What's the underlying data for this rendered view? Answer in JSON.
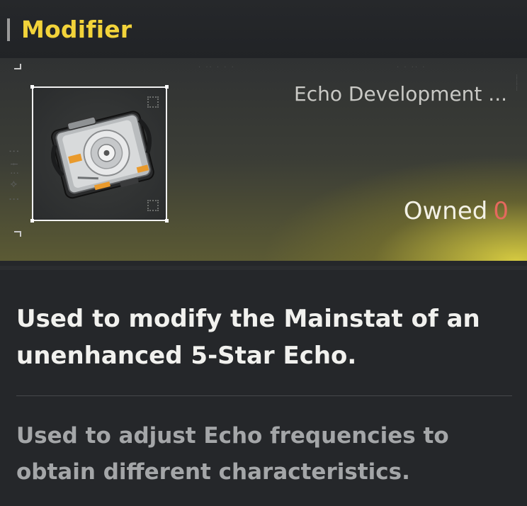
{
  "header": {
    "title": "Modifier"
  },
  "item": {
    "type_label": "Echo Development ...",
    "owned_label": "Owned",
    "owned_count": "0",
    "icon_name": "echo-modifier-device-icon"
  },
  "description": {
    "main": "Used to modify the Mainstat of an unenhanced 5-Star Echo.",
    "lore": "Used to adjust Echo frequencies to obtain different characteristics."
  },
  "colors": {
    "title": "#f2d33a",
    "owned_count": "#e5695e",
    "hero_glow": "#e2d642"
  }
}
